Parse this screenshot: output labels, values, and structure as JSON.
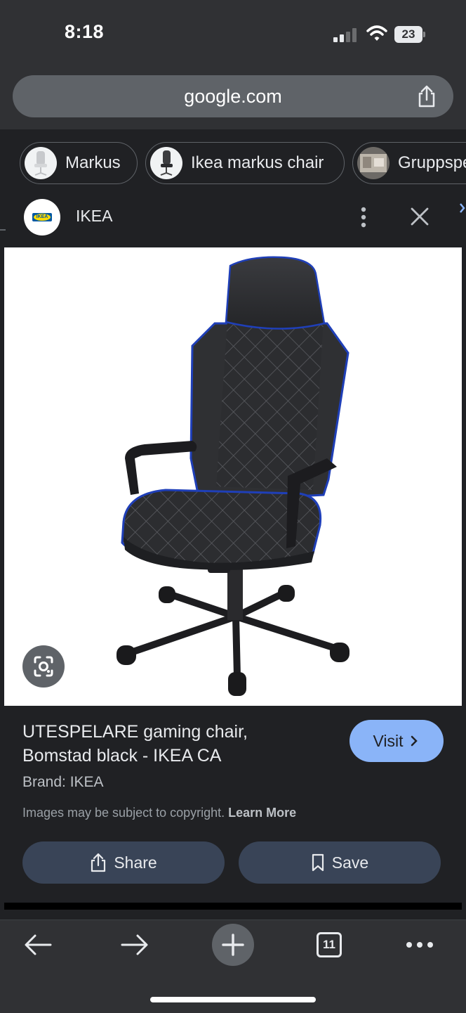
{
  "status_bar": {
    "time": "8:18",
    "battery": "23"
  },
  "browser": {
    "url": "google.com",
    "tab_count": "11"
  },
  "chips": [
    {
      "label": "Markus"
    },
    {
      "label": "Ikea markus chair"
    },
    {
      "label": "Gruppspe"
    }
  ],
  "source": {
    "name": "IKEA",
    "logo_text": "IKEA"
  },
  "result": {
    "title_line1": "UTESPELARE gaming chair,",
    "title_line2": "Bomstad black - IKEA CA",
    "brand": "Brand: IKEA",
    "copyright": "Images may be subject to copyright.",
    "learn_more": "Learn More",
    "visit_label": "Visit",
    "share_label": "Share",
    "save_label": "Save"
  },
  "colors": {
    "accent": "#8ab4f8",
    "chair_trim": "#1f3fb8",
    "background": "#202124"
  },
  "icons": [
    "share-icon",
    "more-vert-icon",
    "close-icon",
    "lens-icon",
    "back-icon",
    "forward-icon",
    "plus-icon",
    "tabs-icon",
    "more-horiz-icon",
    "bookmark-icon"
  ]
}
